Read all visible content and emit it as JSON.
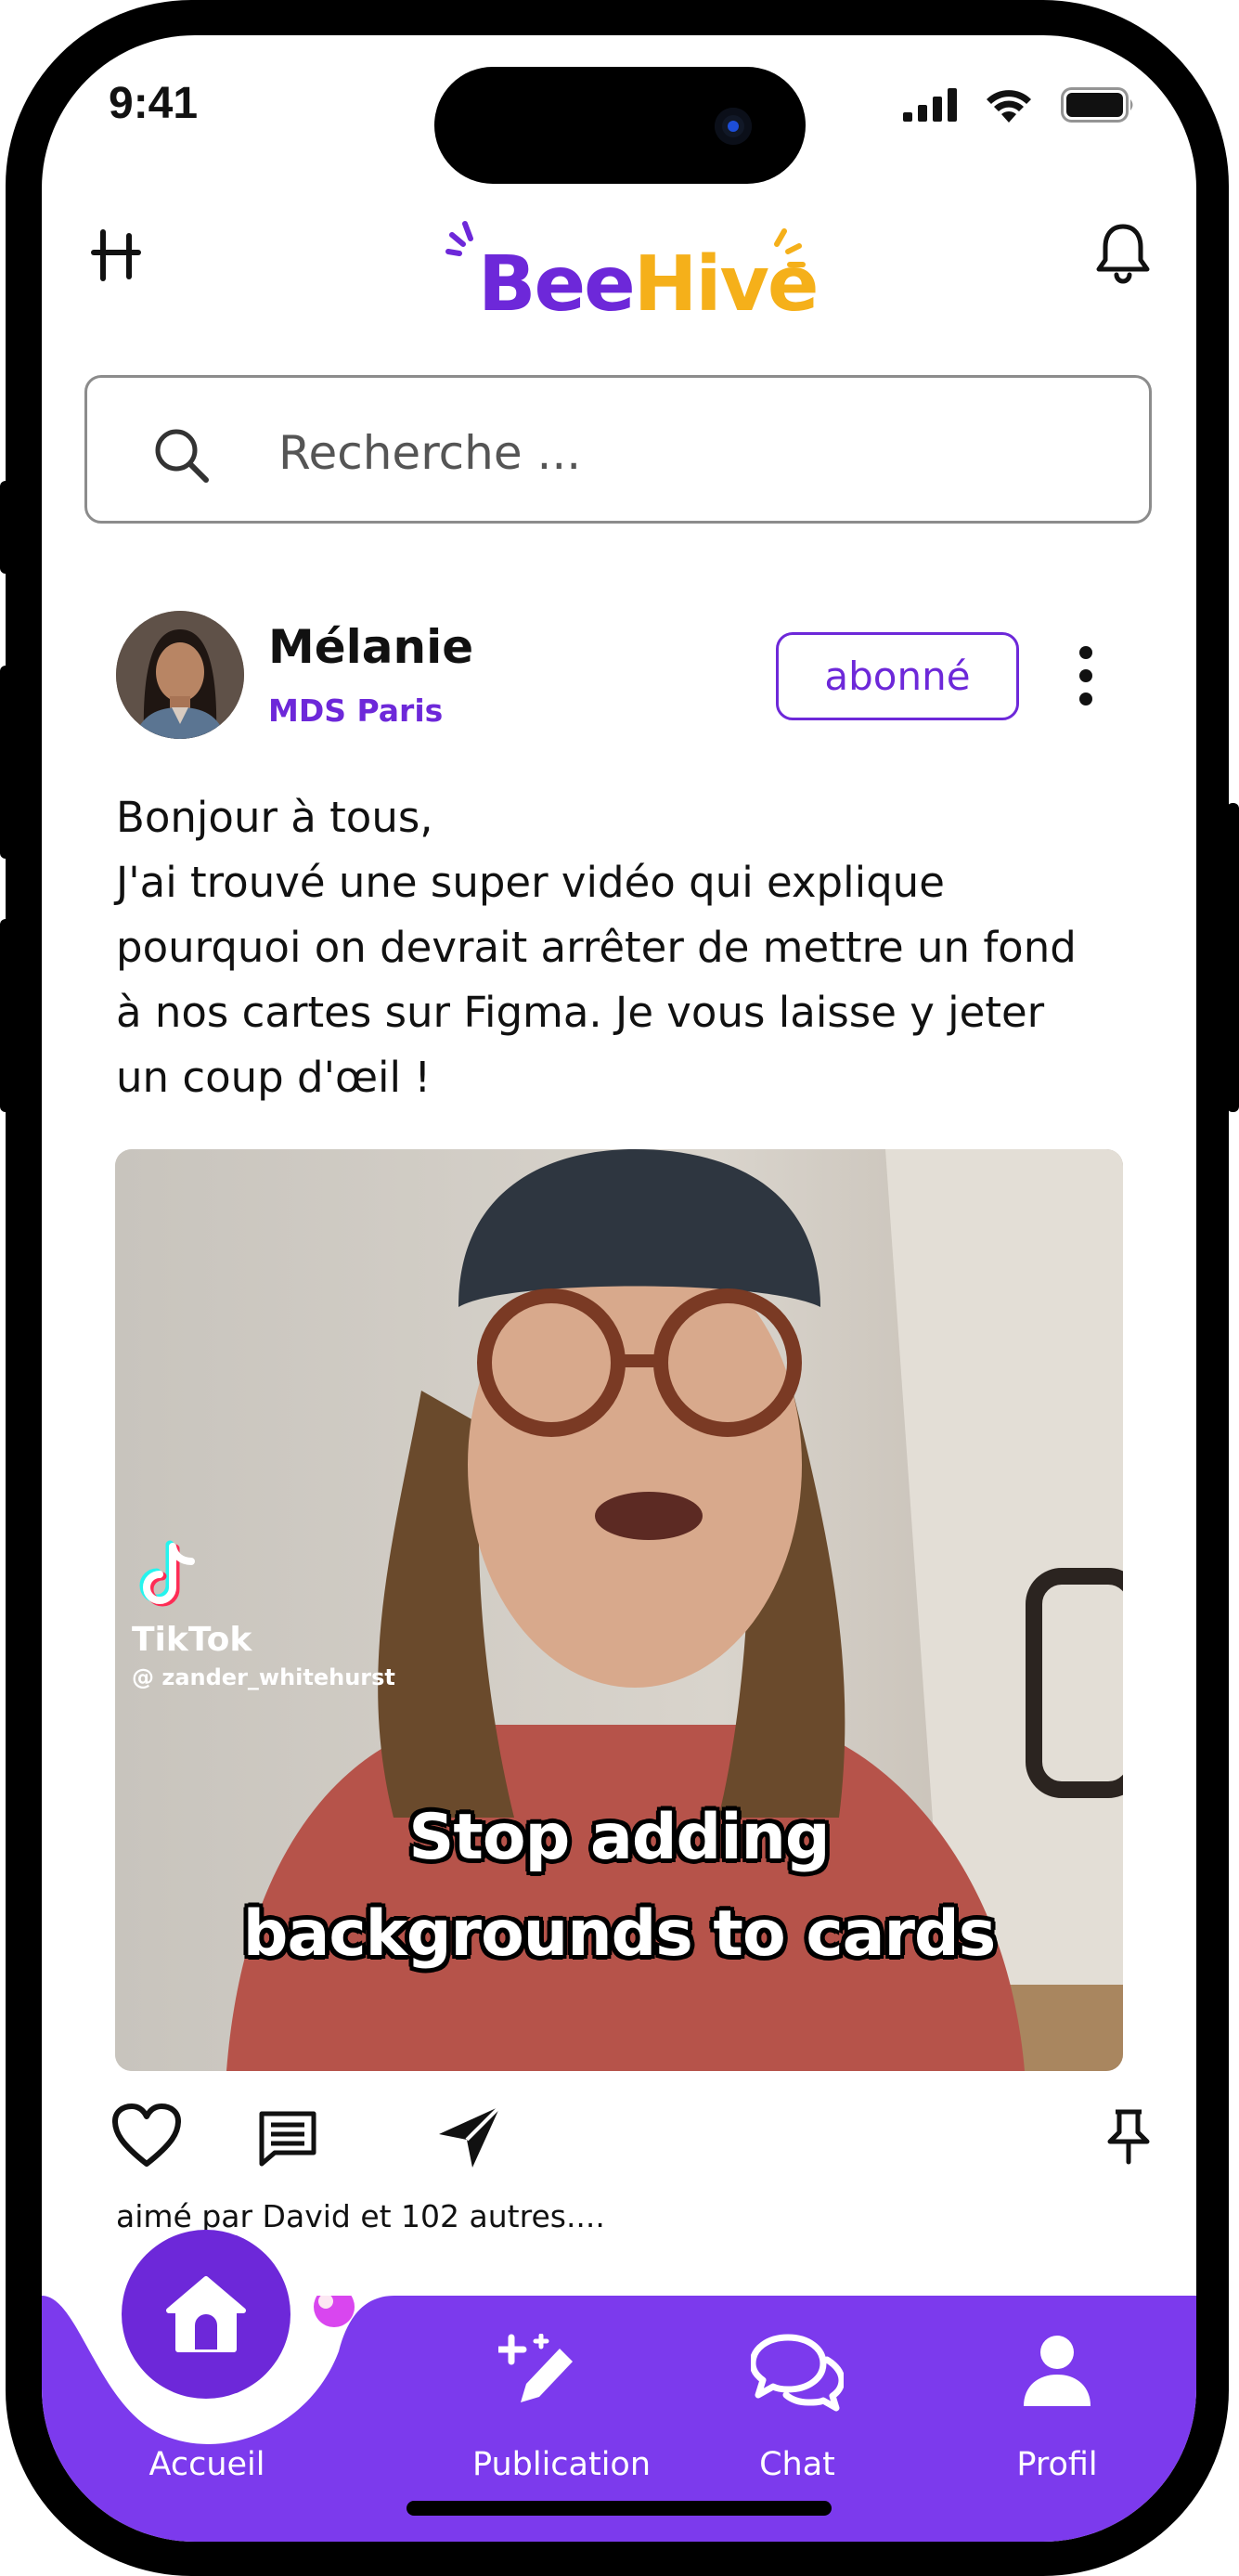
{
  "status_bar": {
    "time": "9:41"
  },
  "header": {
    "logo_part1": "Bee",
    "logo_part2": "Hive"
  },
  "search": {
    "placeholder": "Recherche ..."
  },
  "post": {
    "author_name": "Mélanie",
    "author_school": "MDS Paris",
    "follow_label": "abonné",
    "text_lines": [
      "Bonjour à tous,",
      "J'ai trouvé une super vidéo qui explique",
      "pourquoi on devrait arrêter de mettre un fond",
      "à nos cartes sur Figma. Je vous laisse y jeter",
      "un coup d'œil !"
    ],
    "media": {
      "watermark_brand": "TikTok",
      "watermark_handle": "@ zander_whitehurst",
      "caption_line1": "Stop adding",
      "caption_line2": "backgrounds to cards"
    },
    "likes_text": "aimé par David et 102 autres...."
  },
  "bottom_nav": {
    "items": [
      {
        "label": "Accueil",
        "icon": "home-icon",
        "active": true
      },
      {
        "label": "Publication",
        "icon": "edit-sparkle-icon",
        "active": false
      },
      {
        "label": "Chat",
        "icon": "chat-bubbles-icon",
        "active": false
      },
      {
        "label": "Profil",
        "icon": "user-icon",
        "active": false
      }
    ]
  },
  "colors": {
    "brand_purple": "#6d28d9",
    "brand_yellow": "#f5b01a",
    "nav_background": "#7c3aed"
  }
}
